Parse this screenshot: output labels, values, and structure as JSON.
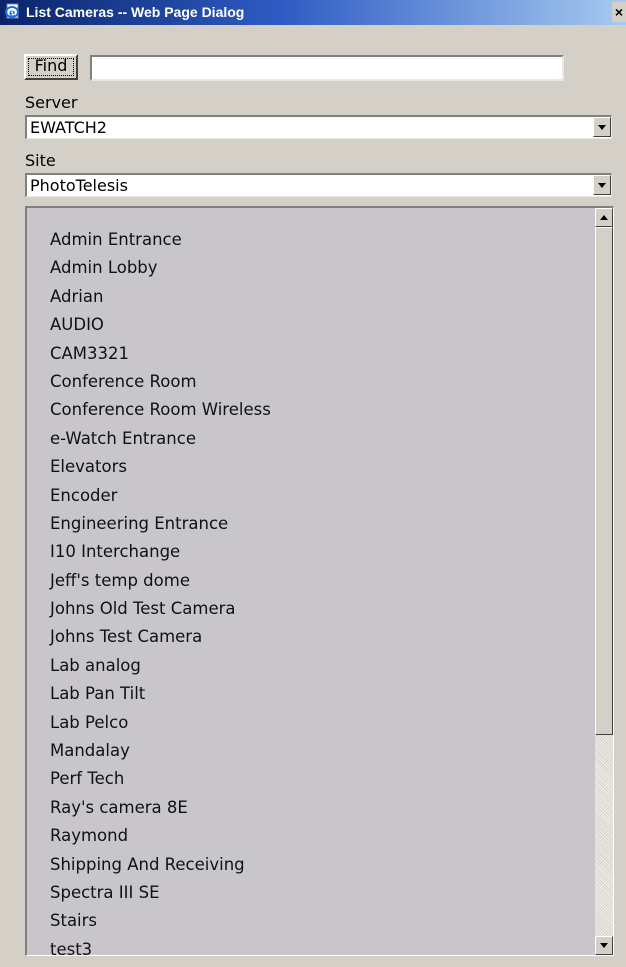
{
  "window": {
    "title": "List Cameras -- Web Page Dialog",
    "close_glyph": "×",
    "icon": "ie-page-icon"
  },
  "find": {
    "button_label": "Find",
    "input_value": ""
  },
  "server": {
    "label": "Server",
    "selected": "EWATCH2"
  },
  "site": {
    "label": "Site",
    "selected": "PhotoTelesis"
  },
  "cameras": [
    "Admin Entrance",
    "Admin Lobby",
    "Adrian",
    "AUDIO",
    "CAM3321",
    "Conference Room",
    "Conference Room Wireless",
    "e-Watch Entrance",
    "Elevators",
    "Encoder",
    "Engineering Entrance",
    "I10 Interchange",
    "Jeff's temp dome",
    "Johns Old Test Camera",
    "Johns Test Camera",
    "Lab analog",
    "Lab Pan Tilt",
    "Lab Pelco",
    "Mandalay",
    "Perf Tech",
    "Ray's camera 8E",
    "Raymond",
    "Shipping And Receiving",
    "Spectra III SE",
    "Stairs",
    "test3"
  ],
  "colors": {
    "title_bar_start": "#0a246a",
    "title_bar_end": "#a6caf0",
    "dialog_background": "#d4d0c8",
    "list_background": "#c9c6cb"
  }
}
